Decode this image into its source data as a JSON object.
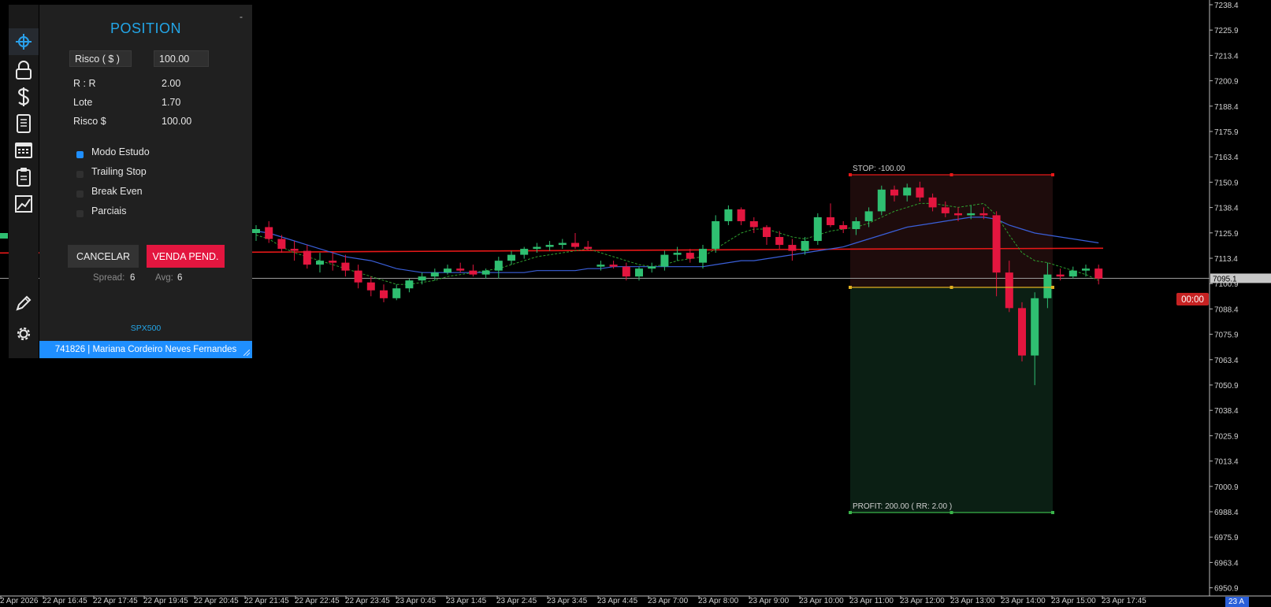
{
  "panel": {
    "title": "POSITION",
    "minimize": "-",
    "risk_mode_label": "Risco ( $ )",
    "risk_value": "100.00",
    "rr_label": "R : R",
    "rr_value": "2.00",
    "lot_label": "Lote",
    "lot_value": "1.70",
    "risk_usd_label": "Risco $",
    "risk_usd_value": "100.00",
    "options": [
      {
        "label": "Modo Estudo",
        "checked": true
      },
      {
        "label": "Trailing Stop",
        "checked": false
      },
      {
        "label": "Break Even",
        "checked": false
      },
      {
        "label": "Parciais",
        "checked": false
      }
    ],
    "cancel_label": "CANCELAR",
    "sell_pending_label": "VENDA PEND.",
    "spread_label": "Spread:",
    "spread_value": "6",
    "avg_label": "Avg:",
    "avg_value": "6",
    "symbol": "SPX500",
    "account_line": "741826  |  Mariana Cordeiro Neves Fernandes"
  },
  "toolbar": {
    "icons": [
      "crosshair-icon",
      "lock-icon",
      "dollar-icon",
      "report-icon",
      "calendar-icon",
      "clipboard-icon",
      "chart-line-icon",
      "pencil-icon",
      "gear-icon"
    ]
  },
  "chart": {
    "stop_label": "STOP: -100.00",
    "profit_label": "PROFIT:  200.00 ( RR: 2.00 )",
    "current_price_tag": "7095.1",
    "timer_tag": "00:00",
    "price_axis": [
      "7238.4",
      "7225.9",
      "7213.4",
      "7200.9",
      "7188.4",
      "7175.9",
      "7163.4",
      "7150.9",
      "7138.4",
      "7125.9",
      "7113.4",
      "7100.9",
      "7088.4",
      "7075.9",
      "7063.4",
      "7050.9",
      "7038.4",
      "7025.9",
      "7013.4",
      "7000.9",
      "6988.4",
      "6975.9",
      "6963.4",
      "6950.9"
    ],
    "time_axis": [
      "2 Apr 2026",
      "22 Apr 16:45",
      "22 Apr 17:45",
      "22 Apr 19:45",
      "22 Apr 20:45",
      "22 Apr 21:45",
      "22 Apr 22:45",
      "22 Apr 23:45",
      "23 Apr 0:45",
      "23 Apr 1:45",
      "23 Apr 2:45",
      "23 Apr 3:45",
      "23 Apr 4:45",
      "23 Apr 7:00",
      "23 Apr 8:00",
      "23 Apr 9:00",
      "23 Apr 10:00",
      "23 Apr 11:00",
      "23 Apr 12:00",
      "23 Apr 13:00",
      "23 Apr 14:00",
      "23 Apr 15:00",
      "23 Apr 17:45"
    ],
    "time_axis_right_tag": "23 A",
    "colors": {
      "bull": "#2fbf71",
      "bear": "#e3163f",
      "stop_zone": "#1e0c0c",
      "profit_zone": "#0b1f14",
      "ma_blue": "#3a5fd9",
      "ma_green": "#2e9e2e",
      "level_red": "#e81818",
      "entry_yellow": "#e0b020"
    },
    "candles": [
      [
        7118,
        7122,
        7114,
        7120
      ],
      [
        7121,
        7124,
        7113,
        7115
      ],
      [
        7115,
        7117,
        7108,
        7110
      ],
      [
        7110,
        7114,
        7104,
        7109
      ],
      [
        7109,
        7112,
        7100,
        7102
      ],
      [
        7102,
        7108,
        7098,
        7104
      ],
      [
        7104,
        7108,
        7099,
        7103
      ],
      [
        7103,
        7107,
        7096,
        7099
      ],
      [
        7099,
        7102,
        7090,
        7093
      ],
      [
        7093,
        7096,
        7086,
        7089
      ],
      [
        7089,
        7092,
        7083,
        7085
      ],
      [
        7085,
        7092,
        7084,
        7090
      ],
      [
        7090,
        7095,
        7088,
        7094
      ],
      [
        7094,
        7098,
        7092,
        7096
      ],
      [
        7096,
        7100,
        7094,
        7098
      ],
      [
        7098,
        7102,
        7097,
        7100
      ],
      [
        7100,
        7103,
        7098,
        7099
      ],
      [
        7099,
        7102,
        7096,
        7097
      ],
      [
        7097,
        7100,
        7095,
        7099
      ],
      [
        7099,
        7106,
        7095,
        7104
      ],
      [
        7104,
        7109,
        7102,
        7107
      ],
      [
        7107,
        7111,
        7105,
        7110
      ],
      [
        7110,
        7113,
        7108,
        7111
      ],
      [
        7111,
        7114,
        7109,
        7112
      ],
      [
        7112,
        7115,
        7110,
        7113
      ],
      [
        7113,
        7118,
        7110,
        7111
      ],
      [
        7111,
        7114,
        7109,
        7110
      ],
      [
        7101,
        7104,
        7099,
        7102
      ],
      [
        7102,
        7104,
        7100,
        7101
      ],
      [
        7101,
        7103,
        7094,
        7096
      ],
      [
        7096,
        7101,
        7094,
        7100
      ],
      [
        7100,
        7103,
        7098,
        7101
      ],
      [
        7101,
        7109,
        7099,
        7107
      ],
      [
        7107,
        7111,
        7104,
        7108
      ],
      [
        7108,
        7110,
        7103,
        7105
      ],
      [
        7103,
        7112,
        7100,
        7110
      ],
      [
        7110,
        7127,
        7108,
        7124
      ],
      [
        7124,
        7132,
        7122,
        7130
      ],
      [
        7130,
        7131,
        7122,
        7124
      ],
      [
        7124,
        7126,
        7118,
        7121
      ],
      [
        7121,
        7122,
        7112,
        7116
      ],
      [
        7116,
        7119,
        7110,
        7112
      ],
      [
        7112,
        7115,
        7104,
        7109
      ],
      [
        7109,
        7116,
        7107,
        7114
      ],
      [
        7114,
        7128,
        7112,
        7126
      ],
      [
        7126,
        7133,
        7121,
        7122
      ],
      [
        7122,
        7124,
        7118,
        7120
      ],
      [
        7120,
        7126,
        7117,
        7124
      ],
      [
        7124,
        7131,
        7121,
        7129
      ],
      [
        7129,
        7142,
        7127,
        7140
      ],
      [
        7140,
        7142,
        7134,
        7137
      ],
      [
        7137,
        7143,
        7134,
        7141
      ],
      [
        7141,
        7144,
        7134,
        7136
      ],
      [
        7136,
        7138,
        7129,
        7131
      ],
      [
        7131,
        7134,
        7126,
        7128
      ],
      [
        7128,
        7131,
        7124,
        7127
      ],
      [
        7127,
        7132,
        7125,
        7128
      ],
      [
        7128,
        7131,
        7125,
        7127
      ],
      [
        7127,
        7129,
        7086,
        7098
      ],
      [
        7098,
        7104,
        7078,
        7080
      ],
      [
        7080,
        7083,
        7053,
        7056
      ],
      [
        7056,
        7088,
        7041,
        7085
      ],
      [
        7085,
        7103,
        7080,
        7097
      ],
      [
        7097,
        7100,
        7094,
        7096
      ],
      [
        7096,
        7101,
        7095,
        7099
      ],
      [
        7099,
        7102,
        7096,
        7100
      ],
      [
        7100,
        7102,
        7092,
        7095
      ]
    ],
    "ma_blue": [
      7119,
      7118,
      7116,
      7114,
      7112,
      7110,
      7108,
      7106,
      7105,
      7104,
      7102,
      7100,
      7099,
      7098,
      7098,
      7098,
      7098,
      7098,
      7098,
      7098,
      7098,
      7098,
      7099,
      7099,
      7099,
      7099,
      7100,
      7100,
      7101,
      7101,
      7101,
      7101,
      7101,
      7101,
      7101,
      7101,
      7102,
      7103,
      7104,
      7104,
      7105,
      7106,
      7107,
      7108,
      7109,
      7110,
      7111,
      7113,
      7115,
      7117,
      7119,
      7121,
      7122,
      7123,
      7124,
      7125,
      7126,
      7126,
      7125,
      7122,
      7120,
      7118,
      7117,
      7116,
      7115,
      7114,
      7113
    ],
    "ma_green": [
      7117,
      7115,
      7111,
      7108,
      7106,
      7104,
      7102,
      7100,
      7098,
      7096,
      7094,
      7092,
      7092,
      7093,
      7094,
      7096,
      7097,
      7098,
      7099,
      7100,
      7102,
      7104,
      7106,
      7107,
      7108,
      7109,
      7110,
      7108,
      7106,
      7104,
      7102,
      7101,
      7102,
      7104,
      7105,
      7106,
      7110,
      7114,
      7118,
      7120,
      7120,
      7118,
      7116,
      7115,
      7117,
      7119,
      7120,
      7121,
      7123,
      7126,
      7129,
      7131,
      7133,
      7133,
      7132,
      7131,
      7132,
      7133,
      7127,
      7117,
      7108,
      7104,
      7103,
      7101,
      7099,
      7097,
      7094
    ],
    "levels": {
      "red_line": 7109.5,
      "current": 7095.1,
      "stop": 7147.5,
      "entry": 7090.5,
      "profit": 6976.5
    }
  }
}
